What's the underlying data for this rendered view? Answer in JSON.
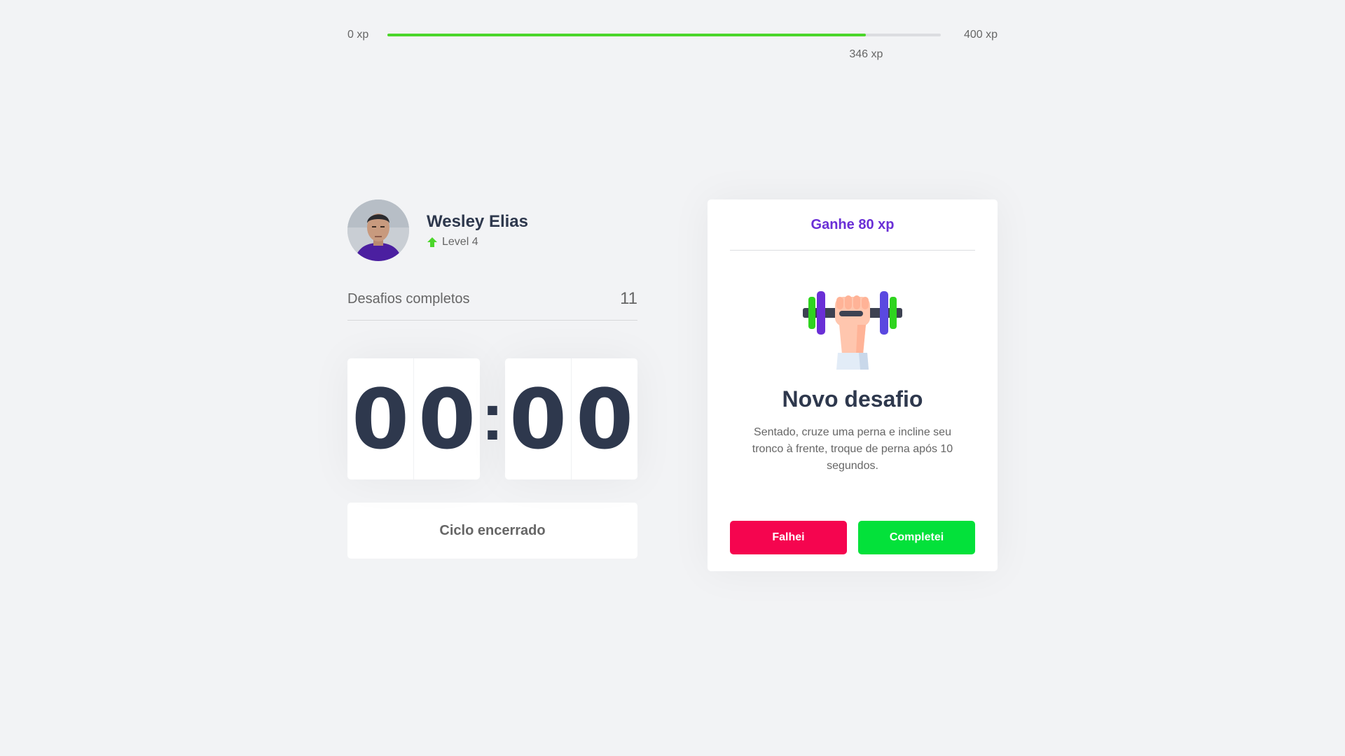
{
  "xp": {
    "min_label": "0 xp",
    "max_label": "400 xp",
    "current_label": "346 xp",
    "current": 346,
    "max": 400,
    "fill_color": "#4cd62b"
  },
  "profile": {
    "name": "Wesley Elias",
    "level_label": "Level 4",
    "level_icon": "level-up-arrow-icon"
  },
  "stats": {
    "completed_label": "Desafios completos",
    "completed_count": "11"
  },
  "countdown": {
    "minutes": [
      "0",
      "0"
    ],
    "colon": ":",
    "seconds": [
      "0",
      "0"
    ]
  },
  "cycle": {
    "button_label": "Ciclo encerrado"
  },
  "challenge": {
    "reward_label": "Ganhe 80 xp",
    "icon": "dumbbell-icon",
    "title": "Novo desafio",
    "description": "Sentado, cruze uma perna e incline seu tronco à frente, troque de perna após 10 segundos.",
    "fail_label": "Falhei",
    "success_label": "Completei"
  },
  "colors": {
    "background": "#f2f3f5",
    "title": "#2e384d",
    "text": "#666666",
    "accent": "#6a2fd6",
    "fail": "#f5054f",
    "success": "#03e13a"
  }
}
